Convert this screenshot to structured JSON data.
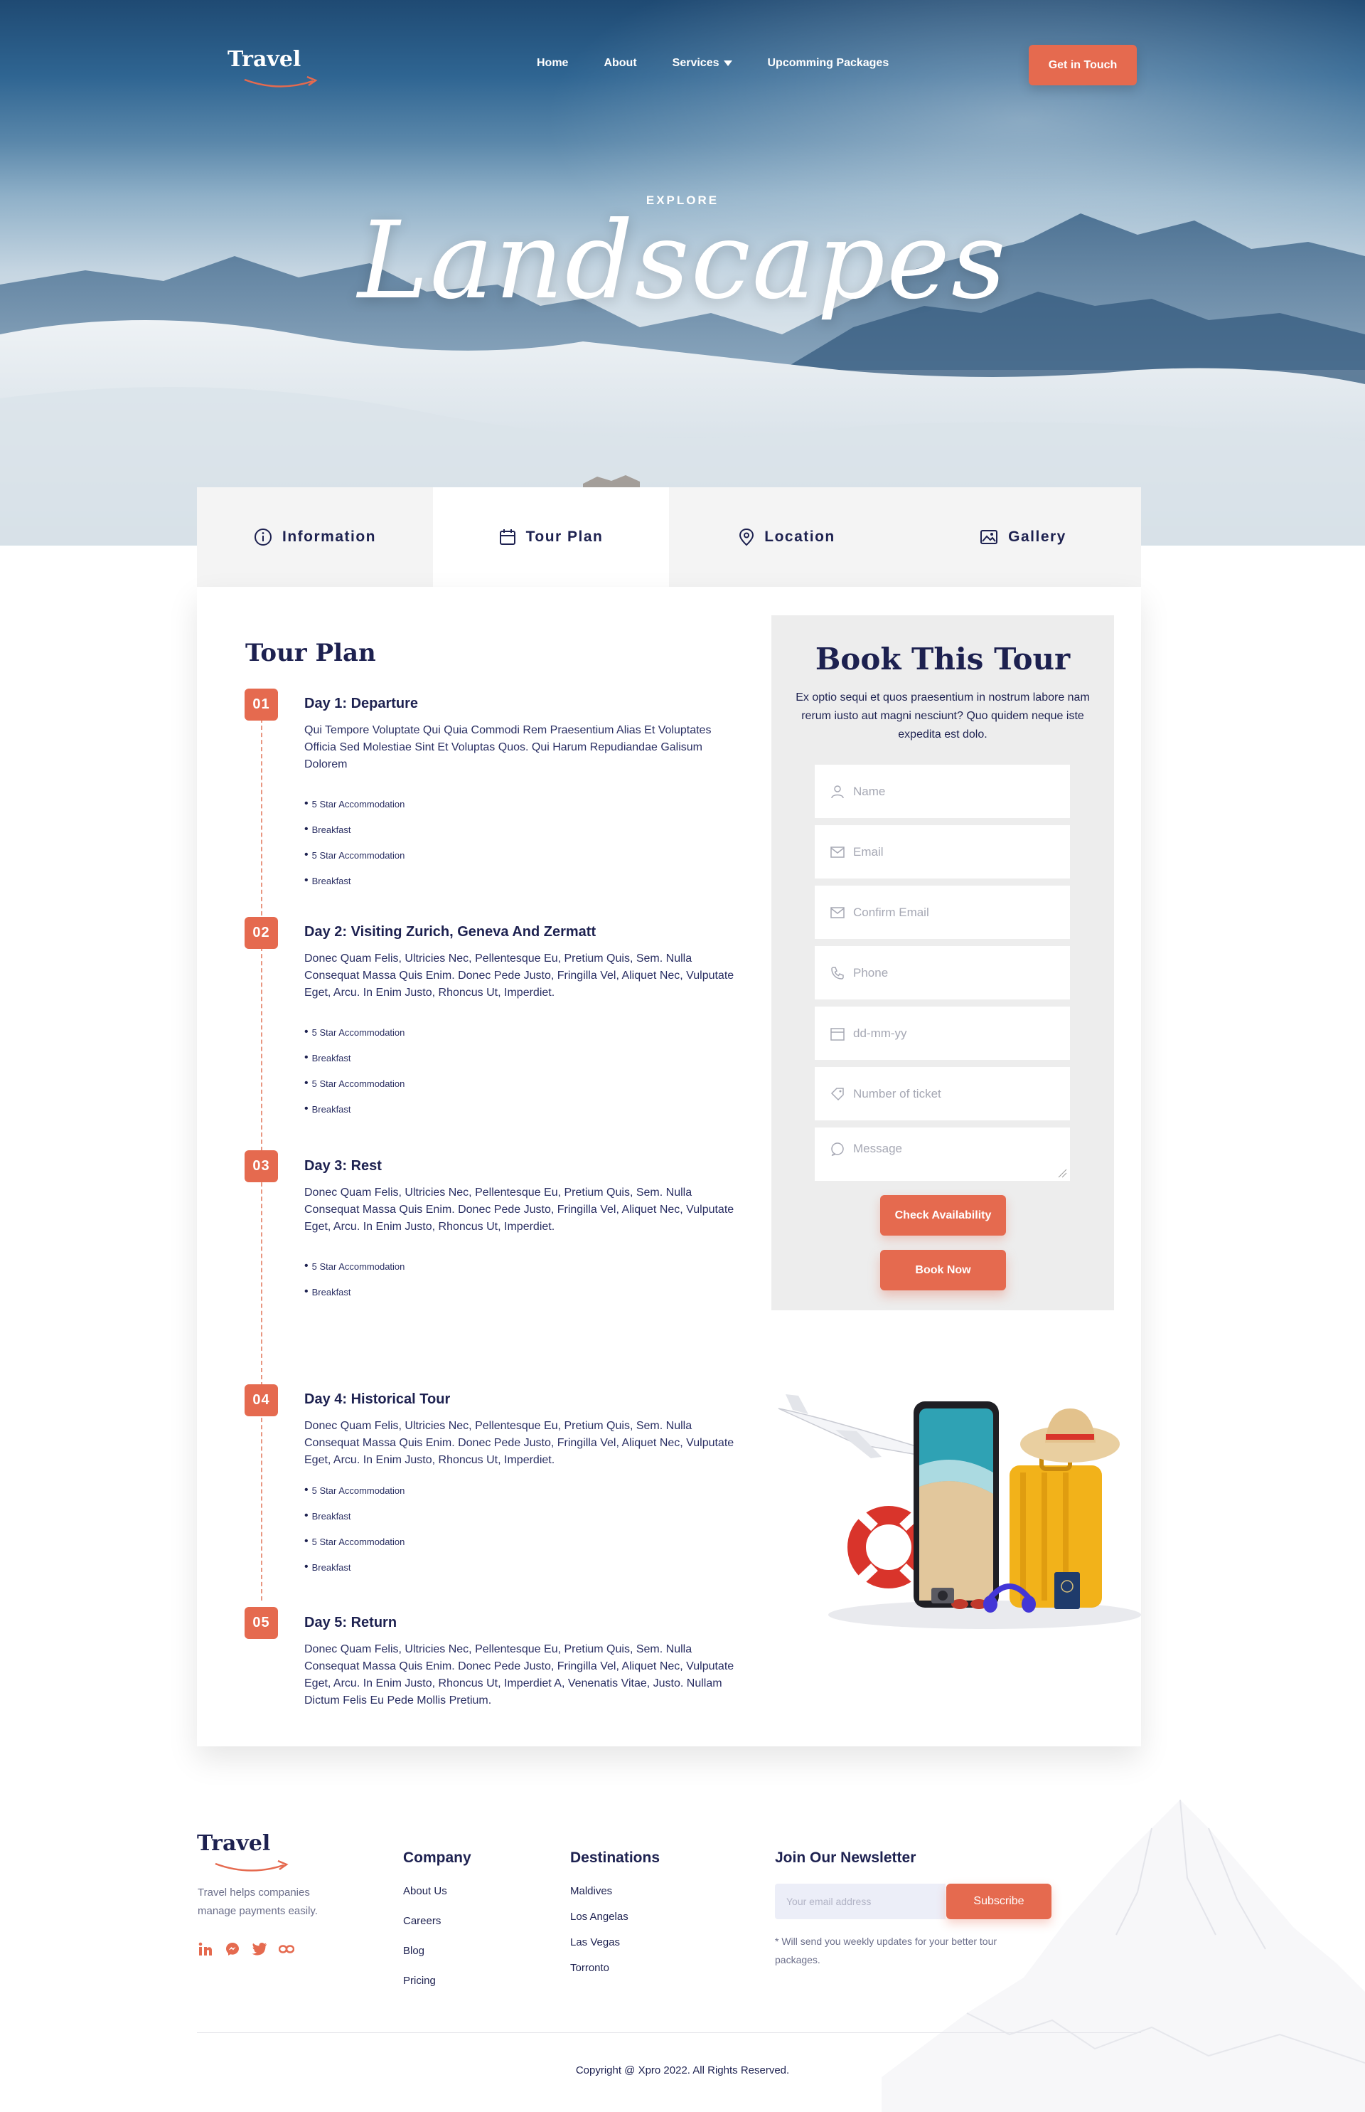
{
  "colors": {
    "accent": "#e56a4f",
    "navy": "#1d2150",
    "panel": "#ededed"
  },
  "nav": {
    "logo": "Travel",
    "links": [
      "Home",
      "About",
      "Services",
      "Upcomming Packages"
    ],
    "cta": "Get in Touch"
  },
  "hero": {
    "eyebrow": "EXPLORE",
    "title": "Landscapes"
  },
  "tabs": [
    {
      "label": "Information",
      "icon": "info-icon"
    },
    {
      "label": "Tour Plan",
      "icon": "calendar-icon",
      "active": true
    },
    {
      "label": "Location",
      "icon": "map-pin-icon"
    },
    {
      "label": "Gallery",
      "icon": "image-icon"
    }
  ],
  "tour_plan": {
    "title": "Tour Plan",
    "days": [
      {
        "badge": "01",
        "title": "Day 1: Departure",
        "desc": "Qui Tempore Voluptate Qui Quia Commodi Rem Praesentium Alias Et Voluptates Officia Sed Molestiae Sint Et Voluptas Quos. Qui Harum Repudiandae Galisum Dolorem",
        "items": [
          "5 Star Accommodation",
          "Breakfast",
          "5 Star Accommodation",
          "Breakfast"
        ]
      },
      {
        "badge": "02",
        "title": "Day 2: Visiting Zurich, Geneva And Zermatt",
        "desc": "Donec Quam Felis, Ultricies Nec, Pellentesque Eu, Pretium Quis, Sem. Nulla Consequat Massa Quis Enim. Donec Pede Justo, Fringilla Vel, Aliquet Nec, Vulputate Eget, Arcu. In Enim Justo, Rhoncus Ut, Imperdiet.",
        "items": [
          "5 Star Accommodation",
          "Breakfast",
          "5 Star Accommodation",
          "Breakfast"
        ]
      },
      {
        "badge": "03",
        "title": "Day 3: Rest",
        "desc": "Donec Quam Felis, Ultricies Nec, Pellentesque Eu, Pretium Quis, Sem. Nulla Consequat Massa Quis Enim. Donec Pede Justo, Fringilla Vel, Aliquet Nec, Vulputate Eget, Arcu. In Enim Justo, Rhoncus Ut, Imperdiet.",
        "items": [
          "5 Star Accommodation",
          "Breakfast"
        ]
      },
      {
        "badge": "04",
        "title": "Day 4: Historical Tour",
        "desc": "Donec Quam Felis, Ultricies Nec, Pellentesque Eu, Pretium Quis, Sem. Nulla Consequat Massa Quis Enim. Donec Pede Justo, Fringilla Vel, Aliquet Nec, Vulputate Eget, Arcu. In Enim Justo, Rhoncus Ut, Imperdiet.",
        "items": [
          "5 Star Accommodation",
          "Breakfast",
          "5 Star Accommodation",
          "Breakfast"
        ]
      },
      {
        "badge": "05",
        "title": "Day 5: Return",
        "desc": "Donec Quam Felis, Ultricies Nec, Pellentesque Eu, Pretium Quis, Sem. Nulla Consequat Massa Quis Enim. Donec Pede Justo, Fringilla Vel, Aliquet Nec, Vulputate Eget, Arcu. In Enim Justo, Rhoncus Ut, Imperdiet A, Venenatis Vitae, Justo. Nullam Dictum Felis Eu Pede Mollis Pretium.",
        "items": []
      }
    ]
  },
  "booking": {
    "title": "Book This Tour",
    "subtitle": "Ex optio sequi et quos praesentium in nostrum labore nam rerum iusto aut magni nesciunt? Quo quidem neque iste expedita est dolo.",
    "fields": [
      {
        "placeholder": "Name",
        "icon": "user-icon"
      },
      {
        "placeholder": "Email",
        "icon": "mail-icon"
      },
      {
        "placeholder": "Confirm Email",
        "icon": "mail-icon"
      },
      {
        "placeholder": "Phone",
        "icon": "phone-icon"
      },
      {
        "placeholder": "dd-mm-yy",
        "icon": "calendar-icon"
      },
      {
        "placeholder": "Number of ticket",
        "icon": "ticket-icon"
      },
      {
        "placeholder": "Message",
        "icon": "chat-icon"
      }
    ],
    "check_label": "Check Availability",
    "book_label": "Book Now"
  },
  "footer": {
    "logo": "Travel",
    "tagline": "Travel helps companies manage payments easily.",
    "social": [
      "linkedin-icon",
      "messenger-icon",
      "twitter-icon",
      "link-icon"
    ],
    "company": {
      "title": "Company",
      "links": [
        "About Us",
        "Careers",
        "Blog",
        "Pricing"
      ]
    },
    "destinations": {
      "title": "Destinations",
      "links": [
        "Maldives",
        "Los Angelas",
        "Las Vegas",
        "Torronto"
      ]
    },
    "newsletter": {
      "title": "Join Our Newsletter",
      "placeholder": "Your email address",
      "button": "Subscribe",
      "note": "* Will send you weekly updates for your better tour packages."
    },
    "copyright": "Copyright @ Xpro 2022. All Rights Reserved."
  }
}
